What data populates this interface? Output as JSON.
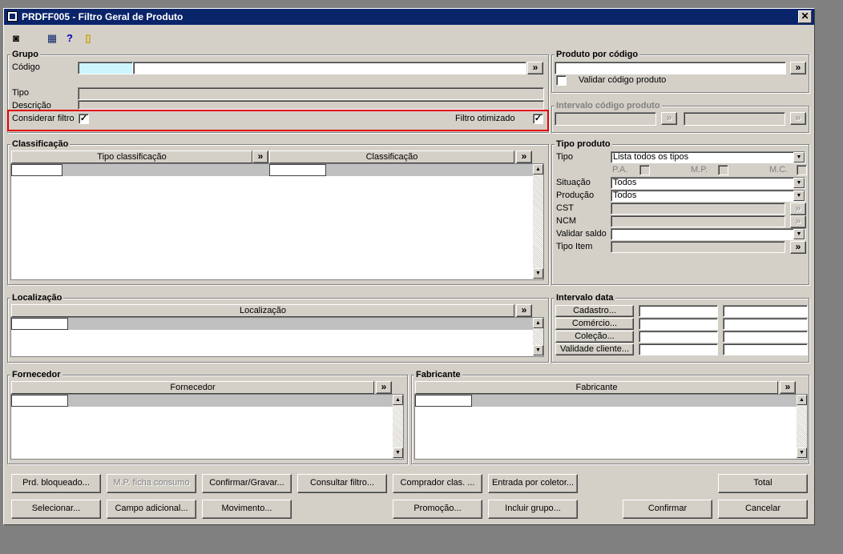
{
  "window": {
    "title": "PRDFF005 - Filtro Geral de Produto",
    "close": "✕"
  },
  "toolbar": [
    {
      "name": "exit-icon",
      "glyph": "◙"
    },
    {
      "name": "calendar-icon",
      "glyph": "▦"
    },
    {
      "name": "help-icon",
      "glyph": "?"
    },
    {
      "name": "door-icon",
      "glyph": "▯"
    }
  ],
  "grupo": {
    "title": "Grupo",
    "codigo_label": "Código",
    "tipo_label": "Tipo",
    "descricao_label": "Descrição",
    "considerar_label": "Considerar filtro",
    "considerar_checked": "✓",
    "otimizado_label": "Filtro otimizado",
    "otimizado_checked": "✓",
    "lookup": "»"
  },
  "produto_codigo": {
    "title": "Produto por código",
    "validar_label": "Validar código produto",
    "lookup": "»"
  },
  "intervalo_codigo": {
    "title": "Intervalo código produto",
    "lookup": "»"
  },
  "classificacao": {
    "title": "Classificação",
    "col1": "Tipo classificação",
    "col2": "Classificação",
    "lookup": "»"
  },
  "tipo_produto": {
    "title": "Tipo produto",
    "tipo_label": "Tipo",
    "tipo_value": "Lista todos os tipos",
    "pa_label": "P.A.",
    "mp_label": "M.P.",
    "mc_label": "M.C.",
    "situacao_label": "Situação",
    "situacao_value": "Todos",
    "producao_label": "Produção",
    "producao_value": "Todos",
    "cst_label": "CST",
    "ncm_label": "NCM",
    "validar_saldo_label": "Validar saldo",
    "tipo_item_label": "Tipo Item",
    "lookup": "»"
  },
  "localizacao": {
    "title": "Localização",
    "col": "Localização",
    "lookup": "»"
  },
  "intervalo_data": {
    "title": "Intervalo data",
    "buttons": [
      "Cadastro...",
      "Comércio...",
      "Coleção...",
      "Validade cliente..."
    ]
  },
  "fornecedor": {
    "title": "Fornecedor",
    "col": "Fornecedor",
    "lookup": "»"
  },
  "fabricante": {
    "title": "Fabricante",
    "col": "Fabricante",
    "lookup": "»"
  },
  "buttons": {
    "prd_bloqueado": "Prd. bloqueado...",
    "mp_ficha": "M.P. ficha consumo",
    "confirmar_gravar": "Confirmar/Gravar...",
    "consultar_filtro": "Consultar filtro...",
    "comprador": "Comprador clas. ...",
    "entrada_coletor": "Entrada por coletor...",
    "total": "Total",
    "selecionar": "Selecionar...",
    "campo_adicional": "Campo adicional...",
    "movimento": "Movimento...",
    "promocao": "Promoção...",
    "incluir_grupo": "Incluir grupo...",
    "confirmar": "Confirmar",
    "cancelar": "Cancelar"
  },
  "scroll": {
    "up": "▲",
    "down": "▼"
  },
  "dropdown": "▼"
}
